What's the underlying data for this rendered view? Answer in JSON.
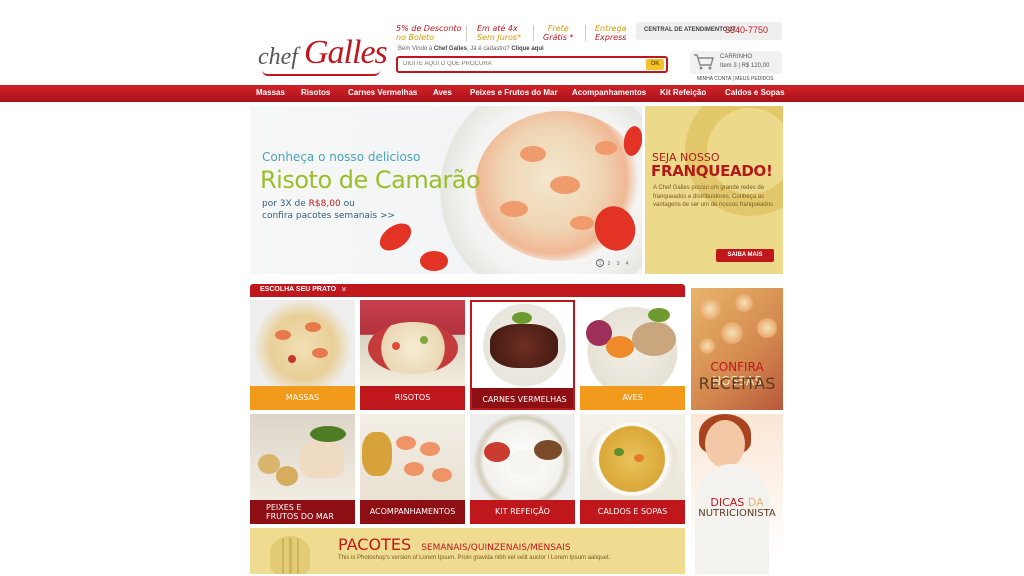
{
  "brand": {
    "logo_chef": "chef",
    "logo_galles": "Galles"
  },
  "promos": [
    {
      "line1": "5% de Desconto",
      "line2": "no Boleto"
    },
    {
      "line1": "Em até 4x",
      "line2": "Sem Juros*"
    },
    {
      "line1": "Frete",
      "line2": "Grátis *"
    },
    {
      "line1": "Entrega",
      "line2": "Express"
    }
  ],
  "contact": {
    "label": "CENTRAL DE ATENDIMENTO 27",
    "phone": "3340-7750"
  },
  "welcome": {
    "prefix": "Bem Vindo à",
    "brand": "Chef Galles",
    "question": ", Já é cadastro?",
    "link": "Clique aqui"
  },
  "search": {
    "placeholder": "DIGITE AQUI O QUE PROCURA",
    "button": "OK"
  },
  "cart": {
    "label": "CARRINHO",
    "items": "Item 3",
    "separator": "|",
    "total": "R$ 120,00"
  },
  "top_links": {
    "account": "MINHA CONTA",
    "separator": "|",
    "orders": "MEUS PEDIDOS"
  },
  "nav": [
    "Massas",
    "Risotos",
    "Carnes Vermelhas",
    "Aves",
    "Peixes e Frutos do Mar",
    "Acompanhamentos",
    "Kit Refeição",
    "Caldos e Sopas"
  ],
  "hero": {
    "line1": "Conheça o nosso delicioso",
    "line2": "Risoto de Camarão",
    "line3_prefix": "por 3X de",
    "price": "R$8,00",
    "line3_suffix": "ou",
    "line4": "confira pacotes semanais >>",
    "pages": [
      "1",
      "2",
      "3",
      "4"
    ]
  },
  "franchise": {
    "title1": "SEJA NOSSO",
    "title2": "FRANQUEADO!",
    "text": "A Chef Galles possui um grande redes de franqueados e distribuidores. Conheça as vantagens de ser um de nossos franqueados",
    "button": "SAIBA MAIS"
  },
  "section": {
    "title": "ESCOLHA SEU PRATO",
    "chevron": "»"
  },
  "tiles": [
    {
      "label": "MASSAS"
    },
    {
      "label": "RISOTOS"
    },
    {
      "label": "CARNES VERMELHAS"
    },
    {
      "label": "AVES"
    },
    {
      "label_l1": "PEIXES E",
      "label_l2": "FRUTOS DO MAR"
    },
    {
      "label": "ACOMPANHAMENTOS"
    },
    {
      "label": "KIT REFEIÇÃO"
    },
    {
      "label": "CALDOS E SOPAS"
    }
  ],
  "side": {
    "recipes_a": "CONFIRA",
    "recipes_b": "NOSSAS",
    "recipes_c": "RECEITAS",
    "nutri_a": "DICAS",
    "nutri_b": "DA",
    "nutri_c": "NUTRICIONISTA"
  },
  "packages": {
    "title": "PACOTES",
    "subtitle": "SEMANAIS/QUINZENAIS/MENSAIS",
    "text": "This is Photoshop's version  of Lorem Ipsum. Proin gravida nibh vel velit auctor I Lorem Ipsum aaliquet."
  },
  "colors": {
    "brand_red": "#c0171d",
    "accent_orange": "#f19a1c",
    "accent_yellow": "#f6c22a"
  }
}
